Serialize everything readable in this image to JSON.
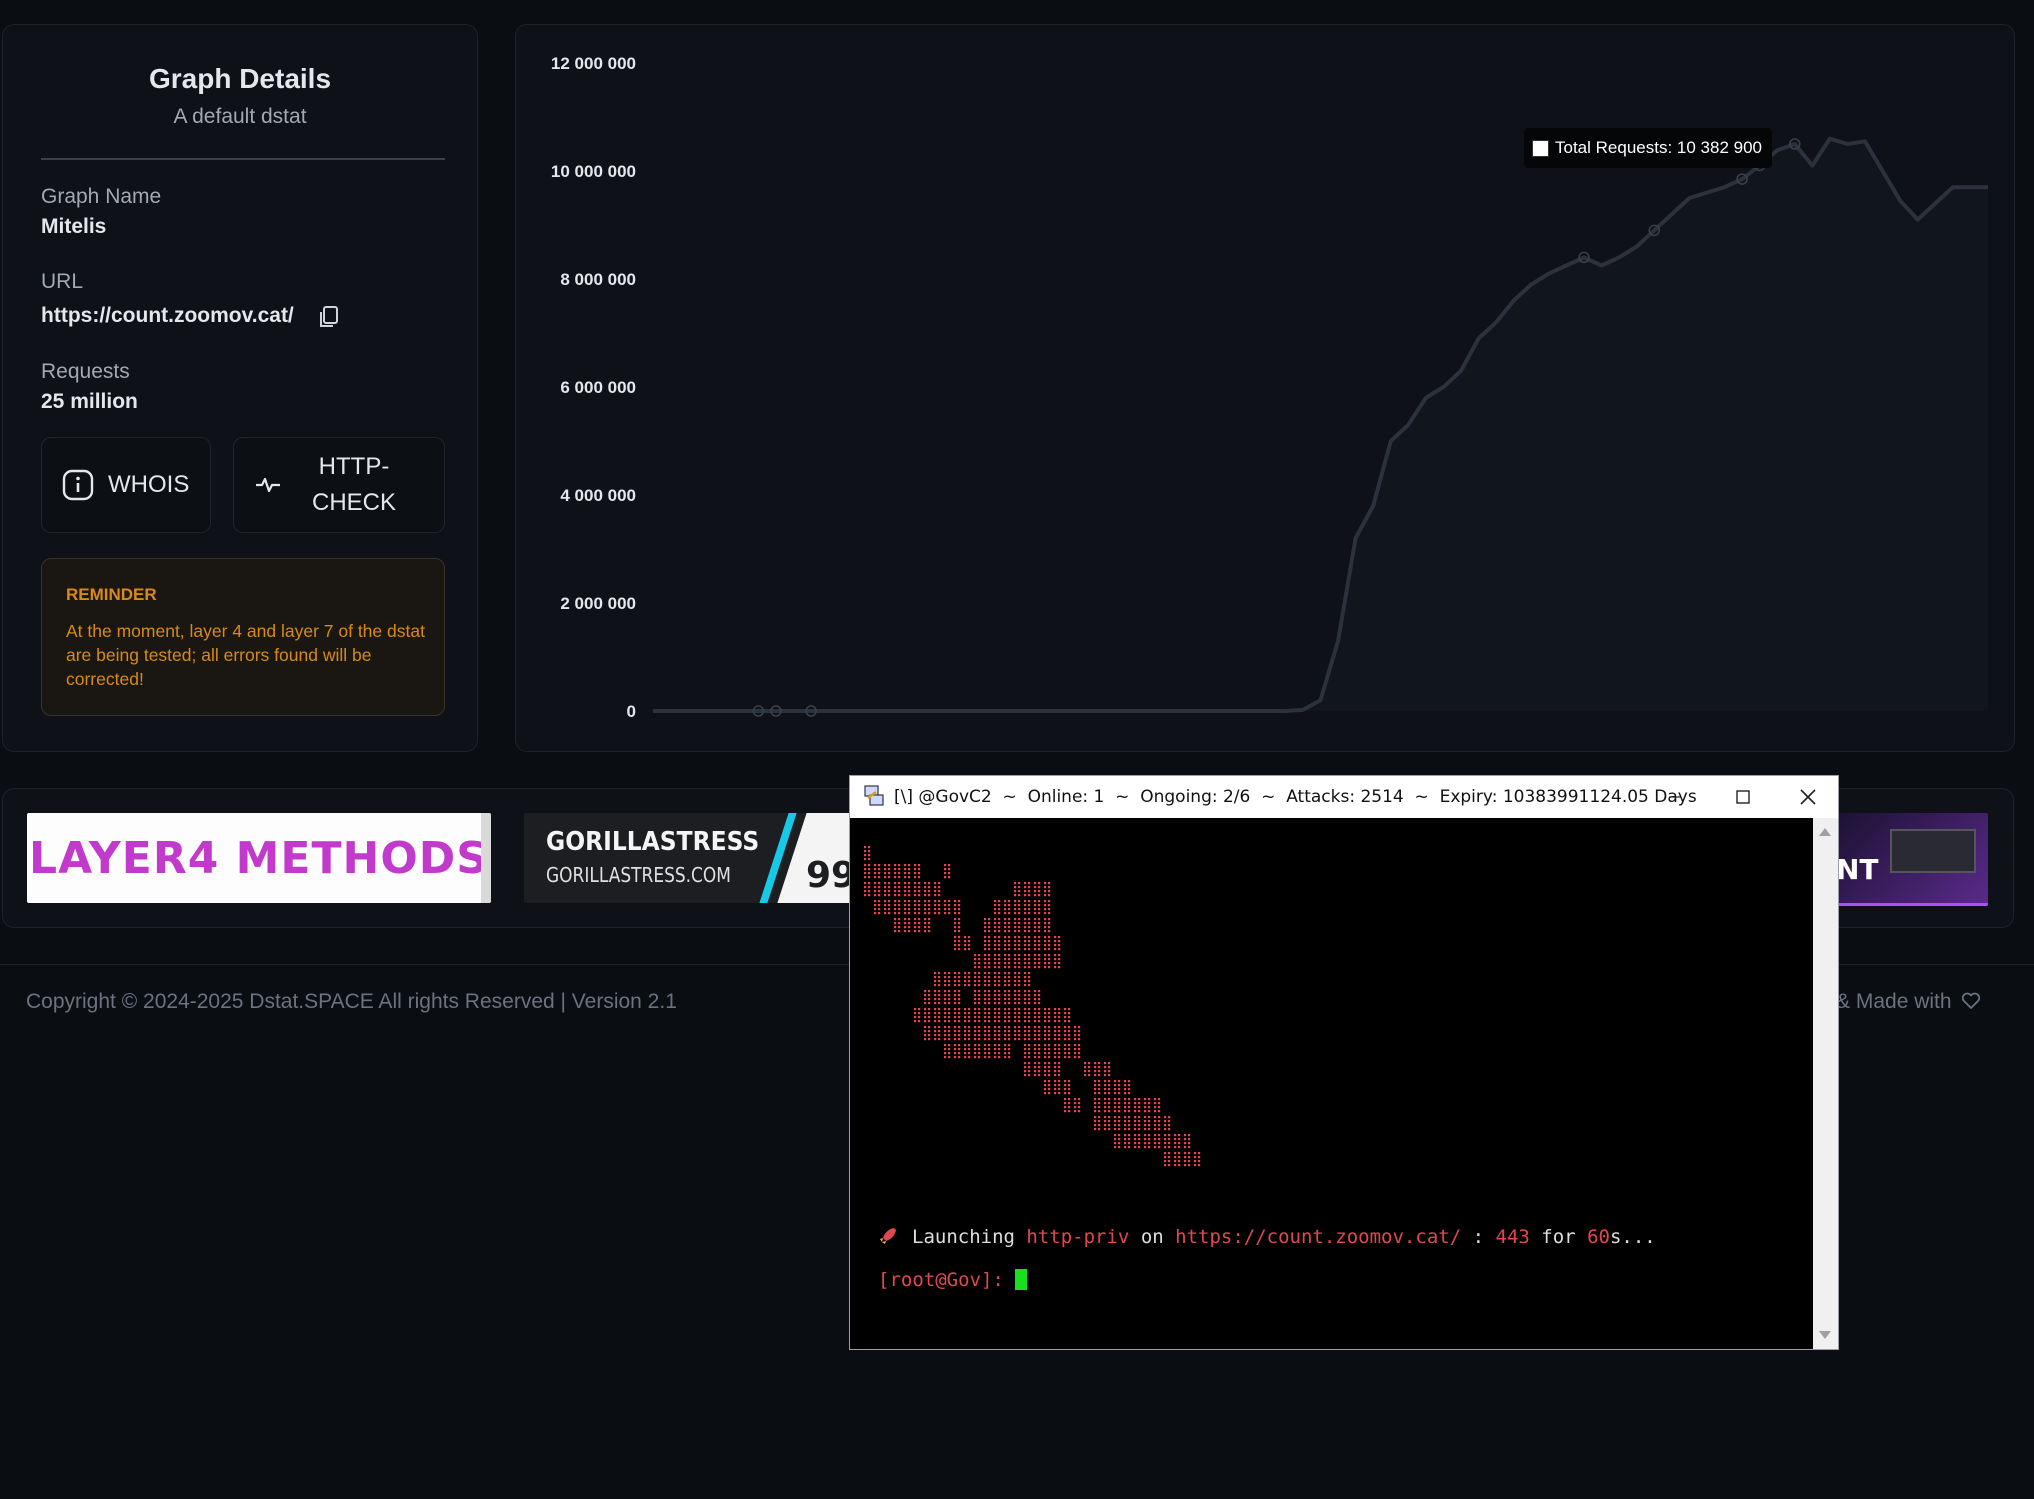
{
  "details": {
    "title": "Graph Details",
    "subtitle": "A default dstat",
    "graph_name_label": "Graph Name",
    "graph_name": "Mitelis",
    "url_label": "URL",
    "url": "https://count.zoomov.cat/",
    "requests_label": "Requests",
    "requests": "25 million",
    "whois_label": "WHOIS",
    "http_check_line1": "HTTP-",
    "http_check_line2": "CHECK",
    "reminder_title": "REMINDER",
    "reminder_text": "At the moment, layer 4 and layer 7 of the dstat are being tested; all errors found will be corrected!"
  },
  "chart_data": {
    "type": "line",
    "series": [
      {
        "name": "Total Requests",
        "y": [
          0,
          0,
          0,
          0,
          0,
          0,
          0,
          0,
          0,
          0,
          0,
          0,
          0,
          0,
          0,
          0,
          0,
          0,
          0,
          0,
          0,
          0,
          0,
          0,
          0,
          0,
          0,
          0,
          0,
          0,
          0,
          0,
          0,
          0,
          0,
          0,
          0,
          20000,
          200000,
          1300000,
          3200000,
          3800000,
          5000000,
          5300000,
          5800000,
          6000000,
          6300000,
          6900000,
          7200000,
          7600000,
          7900000,
          8100000,
          8250000,
          8400000,
          8250000,
          8400000,
          8600000,
          8900000,
          9200000,
          9500000,
          9600000,
          9700000,
          9850000,
          10100000,
          10382900,
          10500000,
          10100000,
          10600000,
          10500000,
          10550000,
          10000000,
          9450000,
          9100000,
          9400000,
          9700000,
          9700000,
          9700000
        ],
        "color": "#2c323b"
      }
    ],
    "y_ticks": [
      "0",
      "2 000 000",
      "4 000 000",
      "6 000 000",
      "8 000 000",
      "10 000 000",
      "12 000 000"
    ],
    "ylim": [
      0,
      12000000
    ],
    "grid": false,
    "tooltip": "Total Requests: 10 382 900"
  },
  "banners": {
    "layer4": "LAYER4 METHODS",
    "gorilla_title": "GORILLASTRESS",
    "gorilla_sub": "GORILLASTRESS.COM",
    "gorilla_num": "99",
    "right_text": "NT"
  },
  "footer": {
    "copyright": "Copyright © 2024-2025 Dstat.SPACE All rights Reserved | Version 2.1",
    "made_with": "& Made with"
  },
  "terminal": {
    "title": "[\\] @GovC2  ~  Online: 1  ~  Ongoing: 2/6  ~  Attacks: 2514  ~  Expiry: 10383991124.05 Days",
    "launch_word": "Launching",
    "method": "http-priv",
    "on_word": "on",
    "target": "https://count.zoomov.cat/",
    "colon": ":",
    "port": "443",
    "for_word": "for",
    "duration": "60",
    "suffix": "s...",
    "prompt": "[root@Gov]: "
  }
}
